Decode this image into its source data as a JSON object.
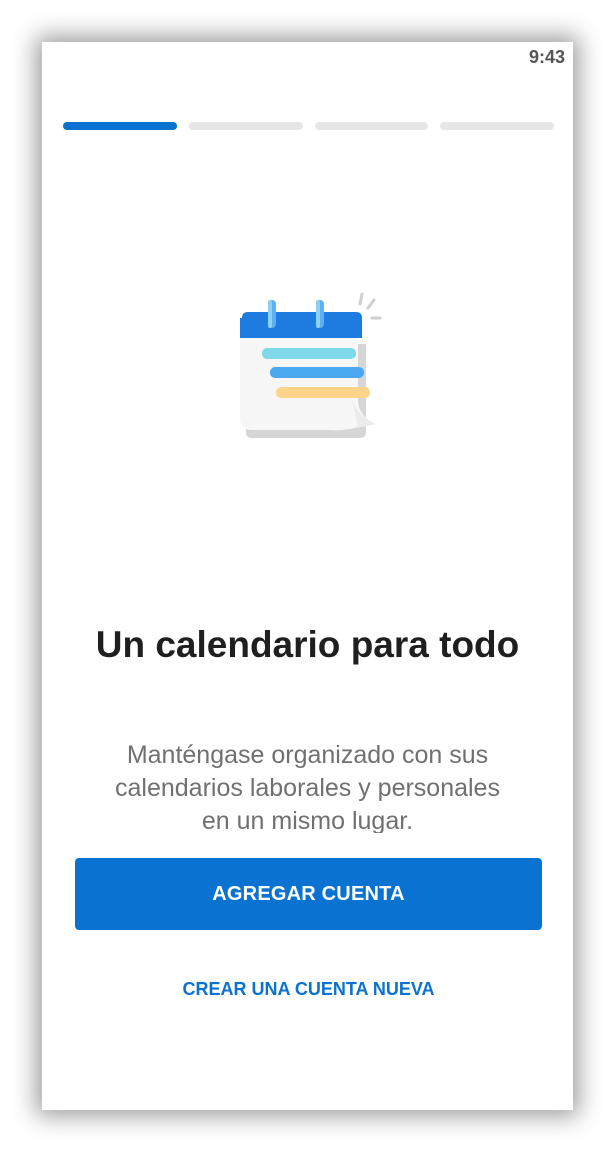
{
  "status_bar": {
    "time": "9:43"
  },
  "progress": {
    "total_steps": 4,
    "current_step": 1
  },
  "illustration": {
    "icon": "calendar-icon",
    "colors": {
      "header": "#1e7be0",
      "line1": "#7fd9e9",
      "line2": "#4aa8f0",
      "line3": "#ffd38a"
    }
  },
  "content": {
    "title": "Un calendario para todo",
    "subtitle": "Manténgase organizado con sus calendarios laborales y personales en un mismo lugar."
  },
  "actions": {
    "primary_label": "AGREGAR CUENTA",
    "secondary_label": "CREAR UNA CUENTA NUEVA"
  },
  "theme": {
    "accent": "#0a72d0",
    "inactive_segment": "#e6e6e6",
    "title_color": "#1f1f1f",
    "subtitle_color": "#707070"
  }
}
